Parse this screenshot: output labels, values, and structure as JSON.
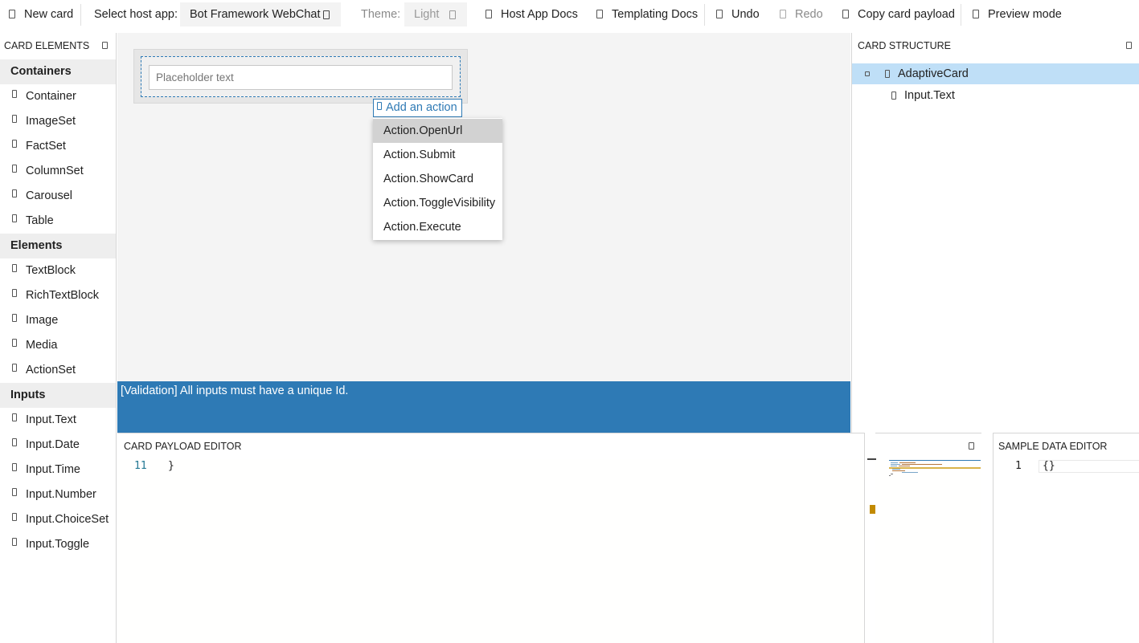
{
  "toolbar": {
    "new_card": "New card",
    "select_host_label": "Select host app:",
    "host_app_value": "Bot Framework WebChat",
    "theme_label": "Theme:",
    "theme_value": "Light",
    "host_app_docs": "Host App Docs",
    "templating_docs": "Templating Docs",
    "undo": "Undo",
    "redo": "Redo",
    "copy_payload": "Copy card payload",
    "preview_mode": "Preview mode"
  },
  "card_elements": {
    "title": "CARD ELEMENTS",
    "categories": [
      {
        "name": "Containers",
        "items": [
          "Container",
          "ImageSet",
          "FactSet",
          "ColumnSet",
          "Carousel",
          "Table"
        ]
      },
      {
        "name": "Elements",
        "items": [
          "TextBlock",
          "RichTextBlock",
          "Image",
          "Media",
          "ActionSet"
        ]
      },
      {
        "name": "Inputs",
        "items": [
          "Input.Text",
          "Input.Date",
          "Input.Time",
          "Input.Number",
          "Input.ChoiceSet",
          "Input.Toggle"
        ]
      }
    ]
  },
  "canvas": {
    "input_placeholder": "Placeholder text",
    "add_action": "Add an action",
    "action_menu": [
      "Action.OpenUrl",
      "Action.Submit",
      "Action.ShowCard",
      "Action.ToggleVisibility",
      "Action.Execute"
    ],
    "hovered_action": "Action.OpenUrl"
  },
  "validation_message": "[Validation] All inputs must have a unique Id.",
  "card_structure": {
    "title": "CARD STRUCTURE",
    "root": "AdaptiveCard",
    "child": "Input.Text"
  },
  "payload_editor": {
    "title": "CARD PAYLOAD EDITOR",
    "line_number": "11",
    "line_text": "}"
  },
  "sample_data_editor": {
    "title": "SAMPLE DATA EDITOR",
    "line_number": "1",
    "line_text": "{}"
  },
  "colors": {
    "accent": "#2e7ab5",
    "selected_row": "#bfdff7",
    "menu_hover": "#d2d2d2",
    "scroll_marker": "#c28a00"
  }
}
